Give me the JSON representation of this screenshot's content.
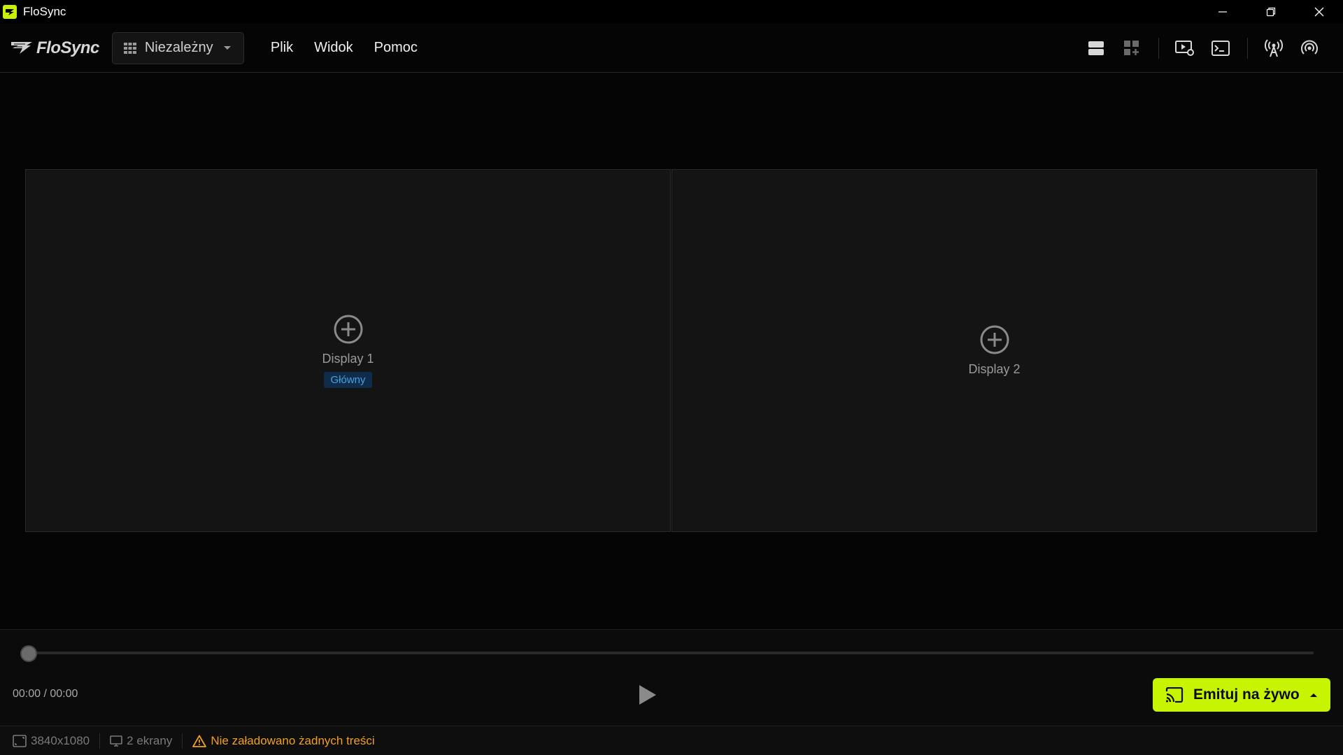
{
  "window": {
    "title": "FloSync"
  },
  "menubar": {
    "logo_text": "FloSync",
    "mode_label": "Niezależny",
    "menu_items": [
      "Plik",
      "Widok",
      "Pomoc"
    ]
  },
  "toolbar": {
    "icons": [
      "layout-rows-icon",
      "add-layout-icon",
      "screen-settings-icon",
      "terminal-icon",
      "broadcast-tower-icon",
      "signal-icon"
    ]
  },
  "displays": [
    {
      "name": "Display 1",
      "badge": "Główny"
    },
    {
      "name": "Display 2",
      "badge": ""
    }
  ],
  "playback": {
    "time": "00:00 / 00:00",
    "progress": 0,
    "live_label": "Emituj na żywo"
  },
  "status": {
    "resolution": "3840x1080",
    "screens": "2 ekrany",
    "warning": "Nie załadowano żadnych treści"
  },
  "colors": {
    "accent": "#c7f400",
    "badge_bg": "#0f2d4a",
    "badge_text": "#4a9fe0",
    "warning": "#f0a020"
  }
}
